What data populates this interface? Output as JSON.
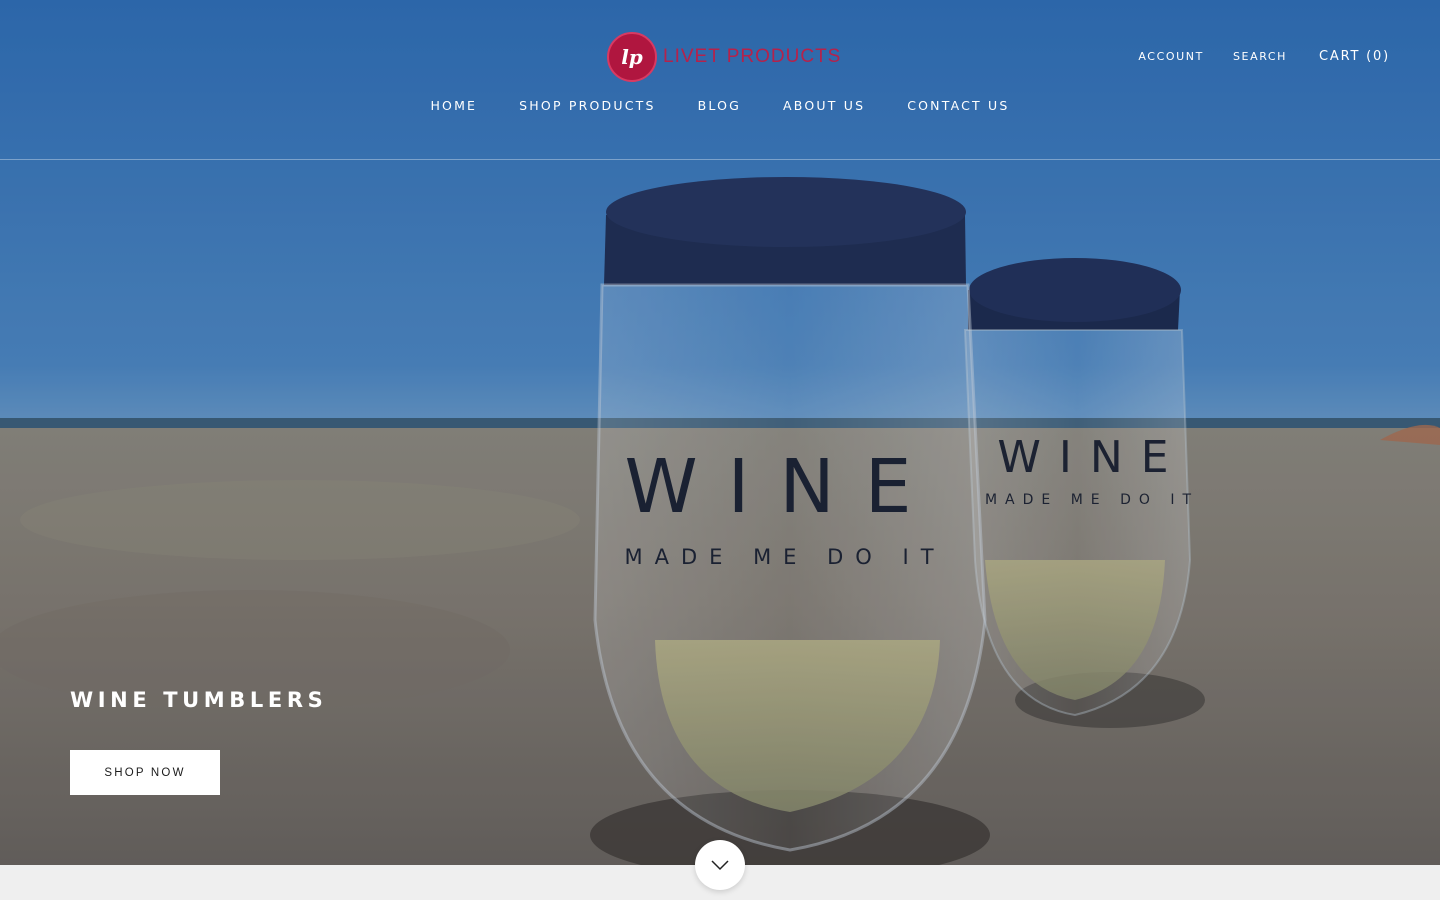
{
  "brand": {
    "logo_mark": "lp",
    "name": "LIVET PRODUCTS",
    "color": "#b0163f"
  },
  "header": {
    "account_label": "ACCOUNT",
    "search_label": "SEARCH",
    "cart_label": "CART (0)"
  },
  "nav": {
    "items": [
      {
        "label": "HOME"
      },
      {
        "label": "SHOP PRODUCTS"
      },
      {
        "label": "BLOG"
      },
      {
        "label": "ABOUT US"
      },
      {
        "label": "CONTACT US"
      }
    ]
  },
  "hero": {
    "title": "WINE TUMBLERS",
    "button_label": "SHOP NOW",
    "tumbler_front_text": "WINE",
    "tumbler_front_subtext": "MADE ME DO IT",
    "tumbler_back_text": "WINE",
    "tumbler_back_subtext": "MADE ME DO IT"
  },
  "icons": {
    "scroll_down": "chevron-down-icon"
  }
}
